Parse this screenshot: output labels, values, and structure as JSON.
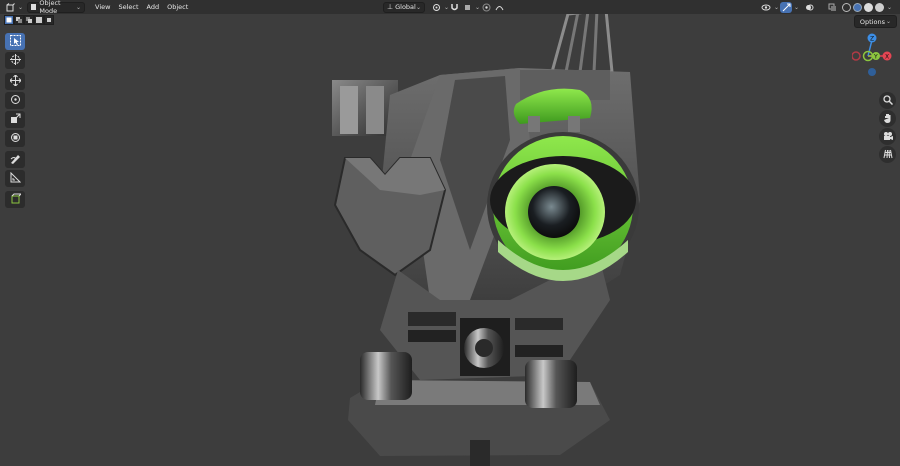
{
  "header": {
    "mode_label": "Object Mode",
    "menus": [
      "View",
      "Select",
      "Add",
      "Object"
    ],
    "transform_orientation": "Global"
  },
  "options_label": "Options",
  "gizmo": {
    "z_label": "Z",
    "y_label": "Y",
    "x_label": "X"
  },
  "colors": {
    "accent": "#4772b3",
    "header_bg": "#303030",
    "viewport_bg": "#3d3d3d",
    "axis_x": "#e64553",
    "axis_y": "#8cc63f",
    "axis_z": "#3c8ee6",
    "eye_green": "#6fd13a"
  },
  "icons": {
    "editor_type": "cube-editor-icon",
    "mode": "object-mode-icon",
    "pivot": "pivot-point-icon",
    "snap": "magnet-icon",
    "proportional": "proportional-edit-icon",
    "visibility": "eye-icon",
    "gizmo_toggle": "gizmo-icon",
    "overlays": "overlay-icon",
    "xray": "xray-icon",
    "shading": [
      "wireframe-icon",
      "solid-icon",
      "material-icon",
      "rendered-icon"
    ],
    "tools": [
      "select-box-icon",
      "cursor-icon",
      "move-icon",
      "rotate-icon",
      "scale-icon",
      "transform-icon",
      "annotate-icon",
      "measure-icon",
      "add-cube-icon"
    ],
    "navigation": [
      "zoom-icon",
      "hand-icon",
      "camera-icon",
      "grid-icon"
    ]
  }
}
